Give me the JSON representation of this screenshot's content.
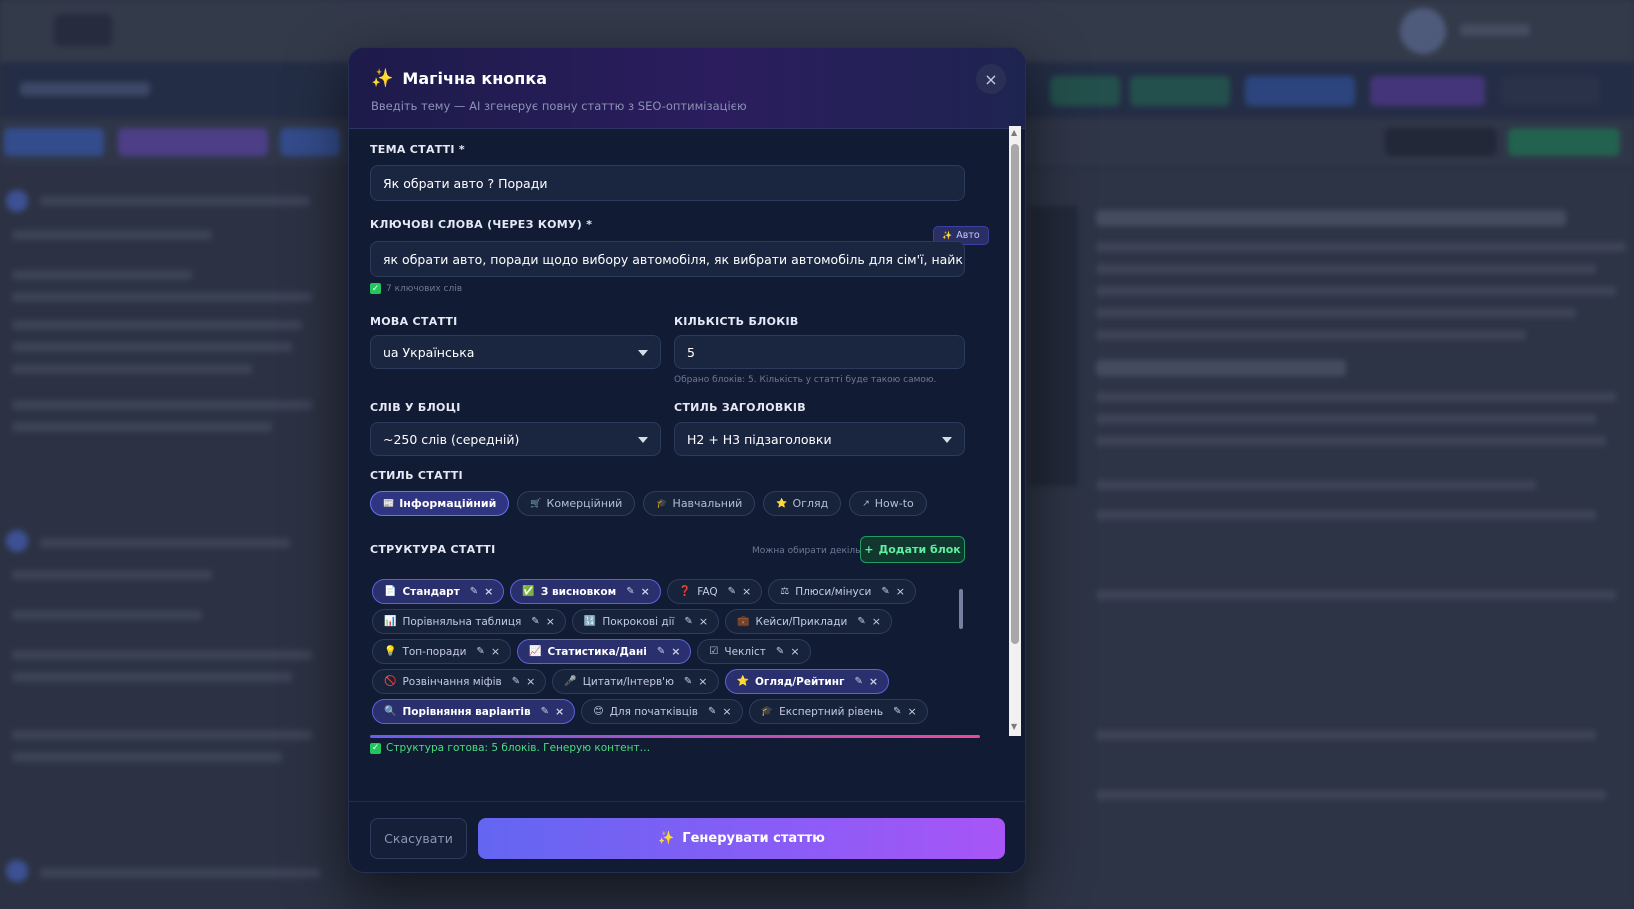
{
  "modal": {
    "title": "Магічна кнопка",
    "subtitle": "Введіть тему — AI згенерує повну статтю з SEO-оптимізацією",
    "close_symbol": "×"
  },
  "topic": {
    "label": "ТЕМА СТАТТІ *",
    "value": "Як обрати авто ? Поради"
  },
  "keywords": {
    "label": "КЛЮЧОВІ СЛОВА (ЧЕРЕЗ КОМУ) *",
    "auto_button": "Авто",
    "value": "як обрати авто, поради щодо вибору автомобіля, як вибрати автомобіль для сім'ї, найкращі автомобілі",
    "count_hint": "7 ключових слів"
  },
  "language": {
    "label": "МОВА СТАТТІ",
    "value": "ua Українська"
  },
  "blocks_count": {
    "label": "КІЛЬКІСТЬ БЛОКІВ",
    "value": "5",
    "hint": "Обрано блоків: 5. Кількість у статті буде такою самою."
  },
  "words_per_block": {
    "label": "СЛІВ У БЛОЦІ",
    "value": "~250 слів (середній)"
  },
  "heading_style": {
    "label": "СТИЛЬ ЗАГОЛОВКІВ",
    "value": "H2 + H3 підзаголовки"
  },
  "article_style": {
    "label": "СТИЛЬ СТАТТІ",
    "options": [
      {
        "icon": "📰",
        "label": "Інформаційний",
        "active": true
      },
      {
        "icon": "🛒",
        "label": "Комерційний",
        "active": false
      },
      {
        "icon": "🎓",
        "label": "Навчальний",
        "active": false
      },
      {
        "icon": "⭐",
        "label": "Огляд",
        "active": false
      },
      {
        "icon": "↗",
        "label": "How-to",
        "active": false
      }
    ]
  },
  "structure": {
    "label": "СТРУКТУРА СТАТТІ",
    "hint": "Можна обирати декілька",
    "add_button": "Додати блок",
    "add_symbol": "+",
    "edit_symbol": "✎",
    "remove_symbol": "×",
    "rows": [
      [
        {
          "icon": "📄",
          "label": "Стандарт",
          "selected": true
        },
        {
          "icon": "✅",
          "label": "З висновком",
          "selected": true
        },
        {
          "icon": "❓",
          "label": "FAQ",
          "selected": false
        },
        {
          "icon": "⚖",
          "label": "Плюси/мінуси",
          "selected": false
        }
      ],
      [
        {
          "icon": "📊",
          "label": "Порівняльна таблиця",
          "selected": false
        },
        {
          "icon": "🔢",
          "label": "Покрокові дії",
          "selected": false
        },
        {
          "icon": "💼",
          "label": "Кейси/Приклади",
          "selected": false
        }
      ],
      [
        {
          "icon": "💡",
          "label": "Топ-поради",
          "selected": false
        },
        {
          "icon": "📈",
          "label": "Статистика/Дані",
          "selected": true
        },
        {
          "icon": "☑",
          "label": "Чекліст",
          "selected": false
        }
      ],
      [
        {
          "icon": "🚫",
          "label": "Розвінчання міфів",
          "selected": false
        },
        {
          "icon": "🎤",
          "label": "Цитати/Інтерв'ю",
          "selected": false
        },
        {
          "icon": "⭐",
          "label": "Огляд/Рейтинг",
          "selected": true
        }
      ],
      [
        {
          "icon": "🔍",
          "label": "Порівняння варіантів",
          "selected": true
        },
        {
          "icon": "😊",
          "label": "Для початківців",
          "selected": false
        },
        {
          "icon": "🎓",
          "label": "Експертний рівень",
          "selected": false
        }
      ]
    ],
    "progress_percent": 100
  },
  "status": {
    "text": "Структура готова: 5 блоків. Генерую контент…",
    "check_symbol": "✓"
  },
  "footer": {
    "cancel": "Скасувати",
    "generate": "Генерувати статтю"
  },
  "icons": {
    "sparkle": "✨",
    "check": "✓",
    "scroll_up": "▲",
    "scroll_down": "▼"
  },
  "colors": {
    "modal_bg": "#111b33",
    "accent": "#6366f1",
    "success": "#22c55e"
  }
}
